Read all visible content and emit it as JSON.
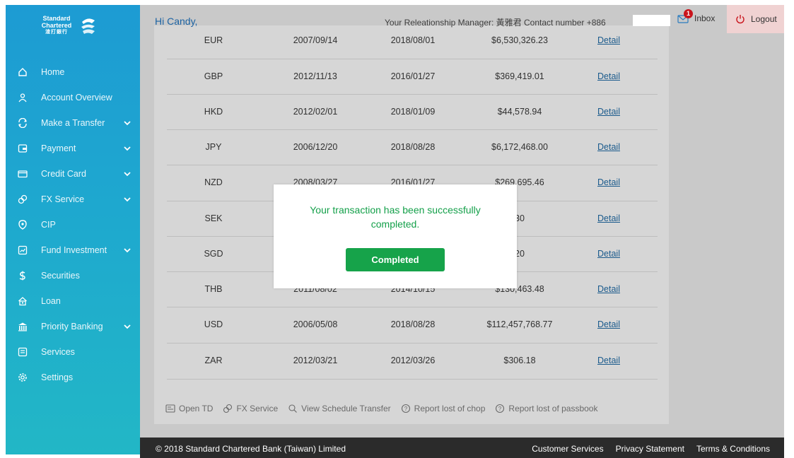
{
  "brand": {
    "line1": "Standard",
    "line2": "Chartered",
    "line3": "渣打銀行"
  },
  "header": {
    "greeting": "Hi Candy,",
    "relationship": "Your Releationship Manager: 黃雅君 Contact number +886",
    "inbox_label": "Inbox",
    "inbox_count": "1",
    "logout_label": "Logout"
  },
  "sidebar": {
    "items": [
      {
        "label": "Home",
        "icon": "home-icon",
        "has_submenu": false
      },
      {
        "label": "Account Overview",
        "icon": "user-icon",
        "has_submenu": false
      },
      {
        "label": "Make a Transfer",
        "icon": "transfer-icon",
        "has_submenu": true
      },
      {
        "label": "Payment",
        "icon": "payment-icon",
        "has_submenu": true
      },
      {
        "label": "Credit Card",
        "icon": "credit-card-icon",
        "has_submenu": true
      },
      {
        "label": "FX Service",
        "icon": "fx-icon",
        "has_submenu": true
      },
      {
        "label": "CIP",
        "icon": "cip-icon",
        "has_submenu": false
      },
      {
        "label": "Fund Investment",
        "icon": "fund-icon",
        "has_submenu": true
      },
      {
        "label": "Securities",
        "icon": "securities-icon",
        "has_submenu": false
      },
      {
        "label": "Loan",
        "icon": "loan-icon",
        "has_submenu": false
      },
      {
        "label": "Priority Banking",
        "icon": "priority-icon",
        "has_submenu": true
      },
      {
        "label": "Services",
        "icon": "services-icon",
        "has_submenu": false
      },
      {
        "label": "Settings",
        "icon": "gear-icon",
        "has_submenu": false
      }
    ]
  },
  "table": {
    "rows": [
      {
        "currency": "EUR",
        "date1": "2007/09/14",
        "date2": "2018/08/01",
        "amount": "$6,530,326.23",
        "link": "Detail"
      },
      {
        "currency": "GBP",
        "date1": "2012/11/13",
        "date2": "2016/01/27",
        "amount": "$369,419.01",
        "link": "Detail"
      },
      {
        "currency": "HKD",
        "date1": "2012/02/01",
        "date2": "2018/01/09",
        "amount": "$44,578.94",
        "link": "Detail"
      },
      {
        "currency": "JPY",
        "date1": "2006/12/20",
        "date2": "2018/08/28",
        "amount": "$6,172,468.00",
        "link": "Detail"
      },
      {
        "currency": "NZD",
        "date1": "2008/03/27",
        "date2": "2016/01/27",
        "amount": "$269,695.46",
        "link": "Detail"
      },
      {
        "currency": "SEK",
        "date1": "",
        "date2": "",
        "amount": "30",
        "link": "Detail"
      },
      {
        "currency": "SGD",
        "date1": "",
        "date2": "",
        "amount": "20",
        "link": "Detail"
      },
      {
        "currency": "THB",
        "date1": "2011/08/02",
        "date2": "2014/10/15",
        "amount": "$130,463.48",
        "link": "Detail"
      },
      {
        "currency": "USD",
        "date1": "2006/05/08",
        "date2": "2018/08/28",
        "amount": "$112,457,768.77",
        "link": "Detail"
      },
      {
        "currency": "ZAR",
        "date1": "2012/03/21",
        "date2": "2012/03/26",
        "amount": "$306.18",
        "link": "Detail"
      }
    ]
  },
  "quick_links": [
    {
      "label": "Open TD",
      "icon": "open-td-icon"
    },
    {
      "label": "FX Service",
      "icon": "fx-icon"
    },
    {
      "label": "View Schedule Transfer",
      "icon": "search-icon"
    },
    {
      "label": "Report lost of chop",
      "icon": "help-icon"
    },
    {
      "label": "Report lost of passbook",
      "icon": "help-icon"
    }
  ],
  "footer": {
    "copyright": "© 2018 Standard Chartered Bank (Taiwan) Limited",
    "links": [
      "Customer Services",
      "Privacy Statement",
      "Terms & Conditions"
    ]
  },
  "modal": {
    "message": "Your transaction has been successfully completed.",
    "button_label": "Completed"
  },
  "colors": {
    "sidebar_top": "#1d9bd3",
    "sidebar_bottom": "#22b7c6",
    "success_green": "#16a34a",
    "link_blue": "#1a5a8c",
    "badge_red": "#c9141c"
  }
}
